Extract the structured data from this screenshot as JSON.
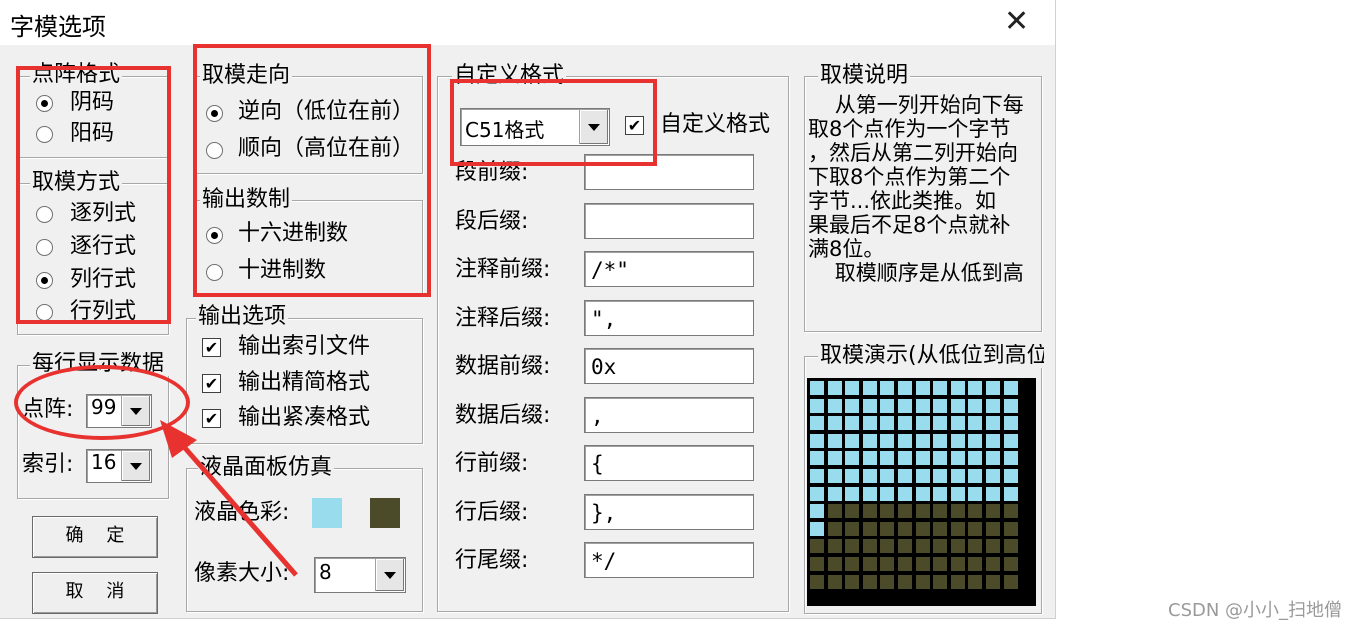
{
  "window": {
    "title": "字模选项",
    "close_icon": "✕"
  },
  "dot_matrix_format": {
    "legend": "点阵格式",
    "options": [
      "阴码",
      "阳码"
    ],
    "selected": 0
  },
  "sampling_mode": {
    "legend": "取模方式",
    "options": [
      "逐列式",
      "逐行式",
      "列行式",
      "行列式"
    ],
    "selected": 2
  },
  "per_line": {
    "legend": "每行显示数据",
    "dot_label": "点阵:",
    "dot_value": "99",
    "index_label": "索引:",
    "index_value": "16"
  },
  "buttons": {
    "ok": "确    定",
    "cancel": "取    消"
  },
  "direction": {
    "legend": "取模走向",
    "options": [
      "逆向（低位在前）",
      "顺向（高位在前）"
    ],
    "selected": 0
  },
  "radix": {
    "legend": "输出数制",
    "options": [
      "十六进制数",
      "十进制数"
    ],
    "selected": 0
  },
  "output_options": {
    "legend": "输出选项",
    "items": [
      {
        "label": "输出索引文件",
        "checked": true
      },
      {
        "label": "输出精简格式",
        "checked": true
      },
      {
        "label": "输出紧凑格式",
        "checked": true
      }
    ]
  },
  "lcd": {
    "legend": "液晶面板仿真",
    "color_label": "液晶色彩:",
    "fg_color": "#99dcee",
    "bg_color": "#4b4b2a",
    "pixel_label": "像素大小:",
    "pixel_value": "8"
  },
  "custom_format": {
    "legend": "自定义格式",
    "format_value": "C51格式",
    "custom_checkbox_label": "自定义格式",
    "custom_checked": true,
    "fields": [
      {
        "label": "段前缀:",
        "value": ""
      },
      {
        "label": "段后缀:",
        "value": ""
      },
      {
        "label": "注释前缀:",
        "value": "/*\""
      },
      {
        "label": "注释后缀:",
        "value": "\","
      },
      {
        "label": "数据前缀:",
        "value": "0x"
      },
      {
        "label": "数据后缀:",
        "value": ","
      },
      {
        "label": "行前缀:",
        "value": "{"
      },
      {
        "label": "行后缀:",
        "value": "},"
      },
      {
        "label": "行尾缀:",
        "value": "*/"
      }
    ]
  },
  "explanation": {
    "legend": "取模说明",
    "text": "    从第一列开始向下每\n取8个点作为一个字节\n，然后从第二列开始向\n下取8个点作为第二个\n字节...依此类推。如\n果最后不足8个点就补\n满8位。\n    取模顺序是从低到高"
  },
  "demo": {
    "legend": "取模演示(从低位到高位)",
    "cols": 12,
    "rows": 12,
    "lit_rows_full": 7,
    "lit_rows_first_col": 9
  },
  "watermark": "CSDN @小小_扫地僧"
}
